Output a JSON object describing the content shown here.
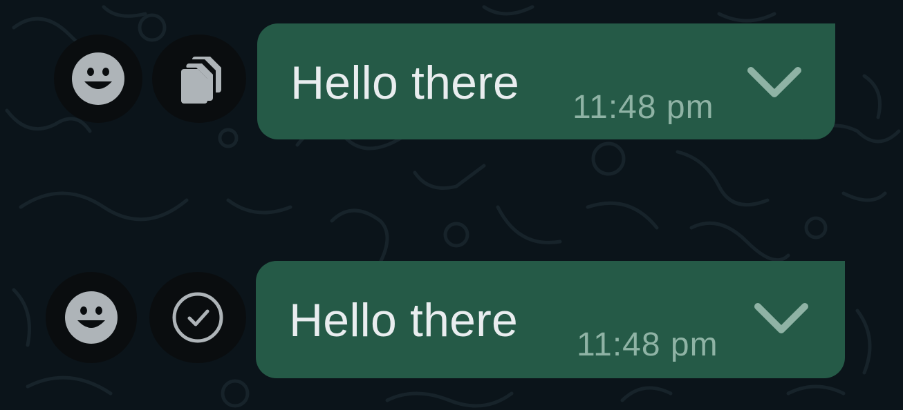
{
  "messages": [
    {
      "text": "Hello there",
      "time": "11:48 pm",
      "actions": [
        {
          "icon": "emoji-smile-icon"
        },
        {
          "icon": "copy-icon"
        }
      ]
    },
    {
      "text": "Hello there",
      "time": "11:48 pm",
      "actions": [
        {
          "icon": "emoji-smile-icon"
        },
        {
          "icon": "check-circle-icon"
        }
      ]
    }
  ],
  "colors": {
    "background": "#0b141a",
    "bubble": "#255a47",
    "text": "#e9edef",
    "time": "#8fb3a5",
    "action_button": "#0a0d0f",
    "icon": "#aeb4b8"
  }
}
